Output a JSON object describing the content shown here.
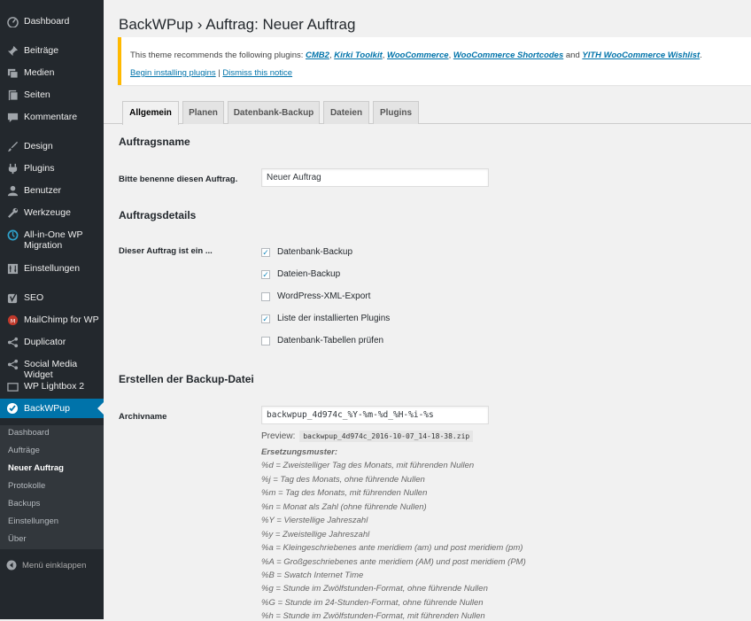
{
  "sidebar": {
    "items": [
      {
        "label": "Dashboard",
        "icon": "dashboard-icon"
      },
      {
        "label": "Beiträge",
        "icon": "pin-icon"
      },
      {
        "label": "Medien",
        "icon": "media-icon"
      },
      {
        "label": "Seiten",
        "icon": "page-icon"
      },
      {
        "label": "Kommentare",
        "icon": "comment-icon"
      },
      {
        "label": "Design",
        "icon": "brush-icon"
      },
      {
        "label": "Plugins",
        "icon": "plugin-icon"
      },
      {
        "label": "Benutzer",
        "icon": "user-icon"
      },
      {
        "label": "Werkzeuge",
        "icon": "wrench-icon"
      },
      {
        "label": "All-in-One WP Migration",
        "icon": "migration-icon"
      },
      {
        "label": "Einstellungen",
        "icon": "settings-icon"
      },
      {
        "label": "SEO",
        "icon": "seo-icon"
      },
      {
        "label": "MailChimp for WP",
        "icon": "mailchimp-icon"
      },
      {
        "label": "Duplicator",
        "icon": "duplicator-icon"
      },
      {
        "label": "Social Media Widget",
        "icon": "share-icon"
      },
      {
        "label": "WP Lightbox 2",
        "icon": "lightbox-icon"
      },
      {
        "label": "BackWPup",
        "icon": "backwpup-icon"
      }
    ],
    "submenu": [
      "Dashboard",
      "Aufträge",
      "Neuer Auftrag",
      "Protokolle",
      "Backups",
      "Einstellungen",
      "Über"
    ],
    "collapse_label": "Menü einklappen"
  },
  "page": {
    "title": "BackWPup › Auftrag: Neuer Auftrag"
  },
  "notice": {
    "text_prefix": "This theme recommends the following plugins: ",
    "plugins": [
      "CMB2",
      "Kirki Toolkit",
      "WooCommerce",
      "WooCommerce Shortcodes",
      "YITH WooCommerce Wishlist"
    ],
    "sep_comma": ", ",
    "sep_and": " and ",
    "text_suffix": ".",
    "install_link": "Begin installing plugins",
    "pipe": " | ",
    "dismiss_link": "Dismiss this notice"
  },
  "tabs": [
    "Allgemein",
    "Planen",
    "Datenbank-Backup",
    "Dateien",
    "Plugins"
  ],
  "form": {
    "section_name_title": "Auftragsname",
    "name_label": "Bitte benenne diesen Auftrag.",
    "name_value": "Neuer Auftrag",
    "section_details_title": "Auftragsdetails",
    "type_label": "Dieser Auftrag ist ein ...",
    "checkboxes": [
      {
        "label": "Datenbank-Backup",
        "checked": true
      },
      {
        "label": "Dateien-Backup",
        "checked": true
      },
      {
        "label": "WordPress-XML-Export",
        "checked": false
      },
      {
        "label": "Liste der installierten Plugins",
        "checked": true
      },
      {
        "label": "Datenbank-Tabellen prüfen",
        "checked": false
      }
    ],
    "section_file_title": "Erstellen der Backup-Datei",
    "archive_label": "Archivname",
    "archive_value": "backwpup_4d974c_%Y-%m-%d_%H-%i-%s",
    "preview_label": "Preview:",
    "preview_value": "backwpup_4d974c_2016-10-07_14-18-38.zip",
    "patterns_title": "Ersetzungsmuster:",
    "patterns": [
      "%d = Zweistelliger Tag des Monats, mit führenden Nullen",
      "%j = Tag des Monats, ohne führende Nullen",
      "%m = Tag des Monats, mit führenden Nullen",
      "%n = Monat als Zahl (ohne führende Nullen)",
      "%Y = Vierstellige Jahreszahl",
      "%y = Zweistellige Jahreszahl",
      "%a = Kleingeschriebenes ante meridiem (am) und post meridiem (pm)",
      "%A = Großgeschriebenes ante meridiem (AM) und post meridiem (PM)",
      "%B = Swatch Internet Time",
      "%g = Stunde im Zwölfstunden-Format, ohne führende Nullen",
      "%G = Stunde im 24-Stunden-Format, ohne führende Nullen",
      "%h = Stunde im Zwölfstunden-Format, mit führenden Nullen"
    ]
  },
  "colors": {
    "sidebar_bg": "#23282d",
    "active_menu": "#0073aa",
    "notice_border": "#ffb900",
    "link": "#0073aa"
  }
}
